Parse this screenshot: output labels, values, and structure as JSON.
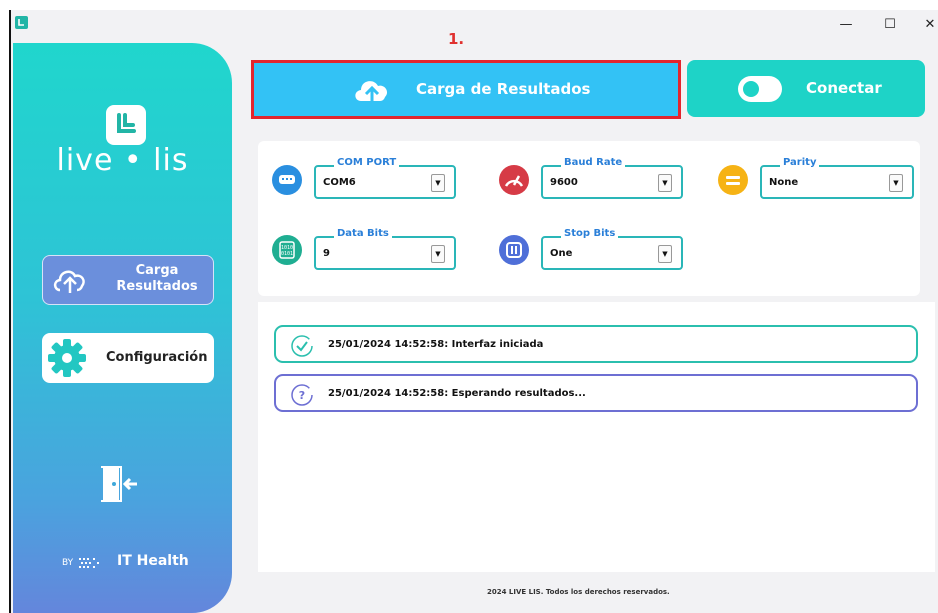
{
  "window": {
    "controls": {
      "minimize": "—",
      "maximize": "☐",
      "close": "✕"
    }
  },
  "annotation": {
    "step": "1."
  },
  "sidebar": {
    "logo_text": "live • lis",
    "items": [
      {
        "label_line1": "Carga",
        "label_line2": "Resultados",
        "icon": "cloud-upload-icon",
        "active": true
      },
      {
        "label": "Configuración",
        "icon": "gear-icon",
        "active": false
      }
    ],
    "exit_icon": "exit-door-icon",
    "by": "BY",
    "brand": "IT Health"
  },
  "toolbar": {
    "carga_label": "Carga de Resultados",
    "conectar_label": "Conectar"
  },
  "settings": {
    "com_port": {
      "label": "COM PORT",
      "value": "COM6",
      "icon": "serial-port-icon",
      "color": "#2a8fe0"
    },
    "baud_rate": {
      "label": "Baud Rate",
      "value": "9600",
      "icon": "speedometer-icon",
      "color": "#d63b46"
    },
    "parity": {
      "label": "Parity",
      "value": "None",
      "icon": "equals-icon",
      "color": "#f6b315"
    },
    "data_bits": {
      "label": "Data Bits",
      "value": "9",
      "icon": "binary-icon",
      "color": "#1fae92"
    },
    "stop_bits": {
      "label": "Stop Bits",
      "value": "One",
      "icon": "pause-icon",
      "color": "#4f6fd8"
    }
  },
  "log": [
    {
      "text": "25/01/2024 14:52:58: Interfaz iniciada",
      "icon": "check-circle-icon",
      "color": "#2bbfae"
    },
    {
      "text": "25/01/2024 14:52:58: Esperando resultados...",
      "icon": "question-circle-icon",
      "color": "#6d6fd3"
    }
  ],
  "footer": "2024 LIVE LIS. Todos los derechos reservados.",
  "colors": {
    "accent_teal": "#1ed3c7",
    "accent_blue": "#33c2f5",
    "highlight_red": "#e3252d"
  }
}
